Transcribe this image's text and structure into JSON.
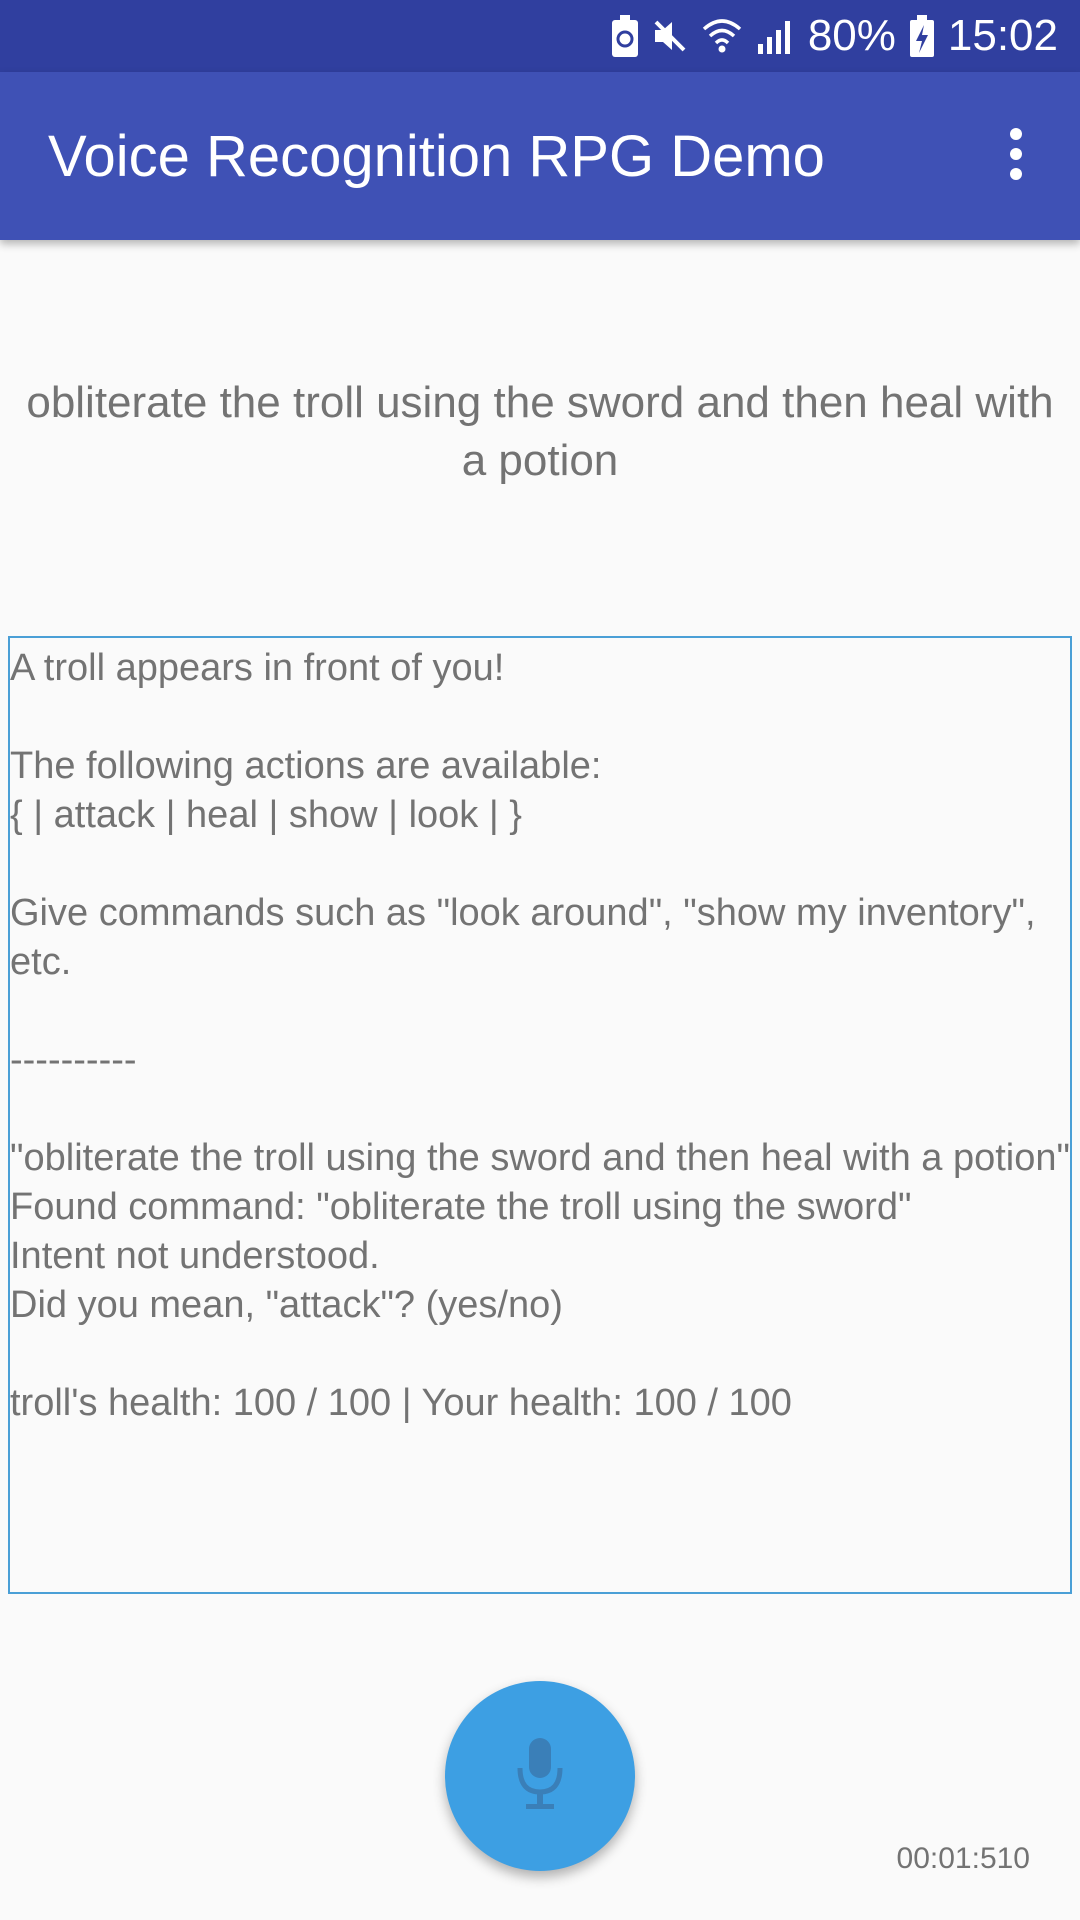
{
  "status_bar": {
    "battery_percent": "80%",
    "time": "15:02",
    "icons": [
      "battery-saver-icon",
      "mute-icon",
      "wifi-icon",
      "signal-icon",
      "battery-charging-icon"
    ]
  },
  "app_bar": {
    "title": "Voice Recognition RPG Demo",
    "menu_icon": "more-vert-icon"
  },
  "recognized_text": "obliterate the troll using the sword and then heal with a potion",
  "log": {
    "text": "A troll appears in front of you!\n\nThe following actions are available:\n{ | attack | heal | show | look | }\n\nGive commands such as \"look around\", \"show my inventory\", etc.\n\n----------\n\n\"obliterate the troll using the sword and then heal with a potion\"\nFound command: \"obliterate the troll using the sword\"\nIntent not understood.\nDid you mean, \"attack\"? (yes/no)\n\ntroll's health: 100 / 100 | Your health: 100 / 100"
  },
  "mic_button": {
    "icon": "mic-icon"
  },
  "timer": "00:01:510",
  "colors": {
    "status_bar": "#303f9f",
    "app_bar": "#3f51b5",
    "fab": "#3d9fe3",
    "log_border": "#4a9fd6",
    "text": "#737373"
  }
}
